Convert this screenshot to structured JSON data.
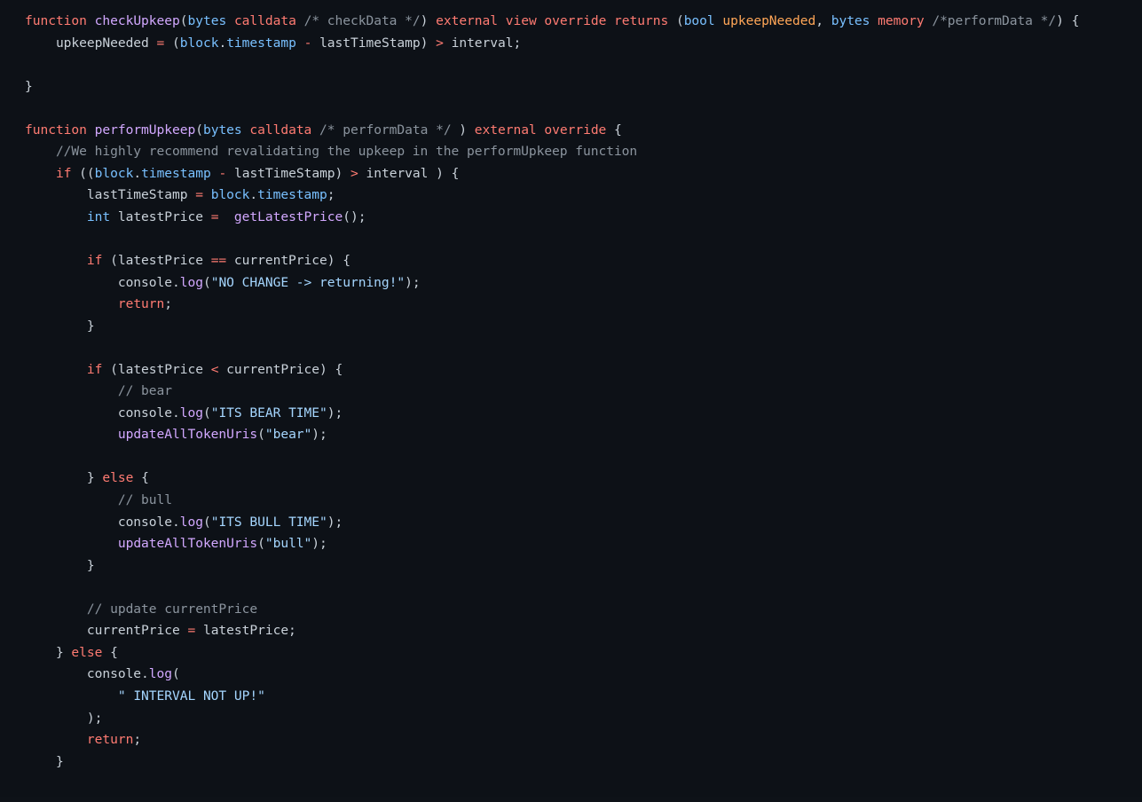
{
  "editor": {
    "language": "solidity",
    "background_color": "#0d1117",
    "default_text_color": "#c9d1d9",
    "theme_name": "github-dark"
  },
  "palette": {
    "keyword": "#ff7b72",
    "function": "#d2a8ff",
    "type": "#79c0ff",
    "string": "#a5d6ff",
    "comment": "#8b949e",
    "parameter": "#ffa657",
    "operator": "#ff7b72",
    "plain": "#c9d1d9"
  },
  "code": {
    "plain_text": "function checkUpkeep(bytes calldata /* checkData */) external view override returns (bool upkeepNeeded, bytes memory /*performData */) {\n    upkeepNeeded = (block.timestamp - lastTimeStamp) > interval;\n\n}\n\nfunction performUpkeep(bytes calldata /* performData */ ) external override {\n    //We highly recommend revalidating the upkeep in the performUpkeep function\n    if ((block.timestamp - lastTimeStamp) > interval ) {\n        lastTimeStamp = block.timestamp;\n        int latestPrice =  getLatestPrice();\n\n        if (latestPrice == currentPrice) {\n            console.log(\"NO CHANGE -> returning!\");\n            return;\n        }\n\n        if (latestPrice < currentPrice) {\n            // bear\n            console.log(\"ITS BEAR TIME\");\n            updateAllTokenUris(\"bear\");\n\n        } else {\n            // bull\n            console.log(\"ITS BULL TIME\");\n            updateAllTokenUris(\"bull\");\n        }\n\n        // update currentPrice\n        currentPrice = latestPrice;\n    } else {\n        console.log(\n            \" INTERVAL NOT UP!\"\n        );\n        return;\n    }",
    "lines": [
      {
        "n": 1,
        "tokens": [
          {
            "t": "function ",
            "c": "kw"
          },
          {
            "t": "checkUpkeep",
            "c": "fn"
          },
          {
            "t": "(",
            "c": "txt"
          },
          {
            "t": "bytes",
            "c": "type"
          },
          {
            "t": " ",
            "c": "txt"
          },
          {
            "t": "calldata",
            "c": "kw"
          },
          {
            "t": " ",
            "c": "txt"
          },
          {
            "t": "/* checkData */",
            "c": "cmt"
          },
          {
            "t": ") ",
            "c": "txt"
          },
          {
            "t": "external view override returns",
            "c": "kw"
          },
          {
            "t": " (",
            "c": "txt"
          },
          {
            "t": "bool",
            "c": "type"
          },
          {
            "t": " ",
            "c": "txt"
          },
          {
            "t": "upkeepNeeded",
            "c": "par"
          },
          {
            "t": ", ",
            "c": "txt"
          },
          {
            "t": "bytes",
            "c": "type"
          },
          {
            "t": " ",
            "c": "txt"
          },
          {
            "t": "memory",
            "c": "kw"
          },
          {
            "t": " ",
            "c": "txt"
          },
          {
            "t": "/*performData */",
            "c": "cmt"
          },
          {
            "t": ") {",
            "c": "txt"
          }
        ]
      },
      {
        "n": 2,
        "tokens": [
          {
            "t": "    upkeepNeeded ",
            "c": "txt"
          },
          {
            "t": "=",
            "c": "op"
          },
          {
            "t": " (",
            "c": "txt"
          },
          {
            "t": "block",
            "c": "type"
          },
          {
            "t": ".",
            "c": "txt"
          },
          {
            "t": "timestamp",
            "c": "prop"
          },
          {
            "t": " ",
            "c": "txt"
          },
          {
            "t": "-",
            "c": "op"
          },
          {
            "t": " lastTimeStamp) ",
            "c": "txt"
          },
          {
            "t": ">",
            "c": "op"
          },
          {
            "t": " interval;",
            "c": "txt"
          }
        ]
      },
      {
        "n": 3,
        "tokens": []
      },
      {
        "n": 4,
        "tokens": [
          {
            "t": "}",
            "c": "txt"
          }
        ]
      },
      {
        "n": 5,
        "tokens": []
      },
      {
        "n": 6,
        "tokens": [
          {
            "t": "function ",
            "c": "kw"
          },
          {
            "t": "performUpkeep",
            "c": "fn"
          },
          {
            "t": "(",
            "c": "txt"
          },
          {
            "t": "bytes",
            "c": "type"
          },
          {
            "t": " ",
            "c": "txt"
          },
          {
            "t": "calldata",
            "c": "kw"
          },
          {
            "t": " ",
            "c": "txt"
          },
          {
            "t": "/* performData */",
            "c": "cmt"
          },
          {
            "t": " ) ",
            "c": "txt"
          },
          {
            "t": "external override",
            "c": "kw"
          },
          {
            "t": " {",
            "c": "txt"
          }
        ]
      },
      {
        "n": 7,
        "tokens": [
          {
            "t": "    //We highly recommend revalidating the upkeep in the performUpkeep function",
            "c": "cmt"
          }
        ]
      },
      {
        "n": 8,
        "tokens": [
          {
            "t": "    ",
            "c": "txt"
          },
          {
            "t": "if",
            "c": "kw"
          },
          {
            "t": " ((",
            "c": "txt"
          },
          {
            "t": "block",
            "c": "type"
          },
          {
            "t": ".",
            "c": "txt"
          },
          {
            "t": "timestamp",
            "c": "prop"
          },
          {
            "t": " ",
            "c": "txt"
          },
          {
            "t": "-",
            "c": "op"
          },
          {
            "t": " lastTimeStamp) ",
            "c": "txt"
          },
          {
            "t": ">",
            "c": "op"
          },
          {
            "t": " interval ) {",
            "c": "txt"
          }
        ]
      },
      {
        "n": 9,
        "tokens": [
          {
            "t": "        lastTimeStamp ",
            "c": "txt"
          },
          {
            "t": "=",
            "c": "op"
          },
          {
            "t": " ",
            "c": "txt"
          },
          {
            "t": "block",
            "c": "type"
          },
          {
            "t": ".",
            "c": "txt"
          },
          {
            "t": "timestamp",
            "c": "prop"
          },
          {
            "t": ";",
            "c": "txt"
          }
        ]
      },
      {
        "n": 10,
        "tokens": [
          {
            "t": "        ",
            "c": "txt"
          },
          {
            "t": "int",
            "c": "type"
          },
          {
            "t": " latestPrice ",
            "c": "txt"
          },
          {
            "t": "=",
            "c": "op"
          },
          {
            "t": "  ",
            "c": "txt"
          },
          {
            "t": "getLatestPrice",
            "c": "fn"
          },
          {
            "t": "();",
            "c": "txt"
          }
        ]
      },
      {
        "n": 11,
        "tokens": []
      },
      {
        "n": 12,
        "tokens": [
          {
            "t": "        ",
            "c": "txt"
          },
          {
            "t": "if",
            "c": "kw"
          },
          {
            "t": " (latestPrice ",
            "c": "txt"
          },
          {
            "t": "==",
            "c": "op"
          },
          {
            "t": " currentPrice) {",
            "c": "txt"
          }
        ]
      },
      {
        "n": 13,
        "tokens": [
          {
            "t": "            console.",
            "c": "txt"
          },
          {
            "t": "log",
            "c": "fn"
          },
          {
            "t": "(",
            "c": "txt"
          },
          {
            "t": "\"NO CHANGE -> returning!\"",
            "c": "str"
          },
          {
            "t": ");",
            "c": "txt"
          }
        ]
      },
      {
        "n": 14,
        "tokens": [
          {
            "t": "            ",
            "c": "txt"
          },
          {
            "t": "return",
            "c": "kw"
          },
          {
            "t": ";",
            "c": "txt"
          }
        ]
      },
      {
        "n": 15,
        "tokens": [
          {
            "t": "        }",
            "c": "txt"
          }
        ]
      },
      {
        "n": 16,
        "tokens": []
      },
      {
        "n": 17,
        "tokens": [
          {
            "t": "        ",
            "c": "txt"
          },
          {
            "t": "if",
            "c": "kw"
          },
          {
            "t": " (latestPrice ",
            "c": "txt"
          },
          {
            "t": "<",
            "c": "op"
          },
          {
            "t": " currentPrice) {",
            "c": "txt"
          }
        ]
      },
      {
        "n": 18,
        "tokens": [
          {
            "t": "            // bear",
            "c": "cmt"
          }
        ]
      },
      {
        "n": 19,
        "tokens": [
          {
            "t": "            console.",
            "c": "txt"
          },
          {
            "t": "log",
            "c": "fn"
          },
          {
            "t": "(",
            "c": "txt"
          },
          {
            "t": "\"ITS BEAR TIME\"",
            "c": "str"
          },
          {
            "t": ");",
            "c": "txt"
          }
        ]
      },
      {
        "n": 20,
        "tokens": [
          {
            "t": "            ",
            "c": "txt"
          },
          {
            "t": "updateAllTokenUris",
            "c": "fn"
          },
          {
            "t": "(",
            "c": "txt"
          },
          {
            "t": "\"bear\"",
            "c": "str"
          },
          {
            "t": ");",
            "c": "txt"
          }
        ]
      },
      {
        "n": 21,
        "tokens": []
      },
      {
        "n": 22,
        "tokens": [
          {
            "t": "        } ",
            "c": "txt"
          },
          {
            "t": "else",
            "c": "kw"
          },
          {
            "t": " {",
            "c": "txt"
          }
        ]
      },
      {
        "n": 23,
        "tokens": [
          {
            "t": "            // bull",
            "c": "cmt"
          }
        ]
      },
      {
        "n": 24,
        "tokens": [
          {
            "t": "            console.",
            "c": "txt"
          },
          {
            "t": "log",
            "c": "fn"
          },
          {
            "t": "(",
            "c": "txt"
          },
          {
            "t": "\"ITS BULL TIME\"",
            "c": "str"
          },
          {
            "t": ");",
            "c": "txt"
          }
        ]
      },
      {
        "n": 25,
        "tokens": [
          {
            "t": "            ",
            "c": "txt"
          },
          {
            "t": "updateAllTokenUris",
            "c": "fn"
          },
          {
            "t": "(",
            "c": "txt"
          },
          {
            "t": "\"bull\"",
            "c": "str"
          },
          {
            "t": ");",
            "c": "txt"
          }
        ]
      },
      {
        "n": 26,
        "tokens": [
          {
            "t": "        }",
            "c": "txt"
          }
        ]
      },
      {
        "n": 27,
        "tokens": []
      },
      {
        "n": 28,
        "tokens": [
          {
            "t": "        // update currentPrice",
            "c": "cmt"
          }
        ]
      },
      {
        "n": 29,
        "tokens": [
          {
            "t": "        currentPrice ",
            "c": "txt"
          },
          {
            "t": "=",
            "c": "op"
          },
          {
            "t": " latestPrice;",
            "c": "txt"
          }
        ]
      },
      {
        "n": 30,
        "tokens": [
          {
            "t": "    } ",
            "c": "txt"
          },
          {
            "t": "else",
            "c": "kw"
          },
          {
            "t": " {",
            "c": "txt"
          }
        ]
      },
      {
        "n": 31,
        "tokens": [
          {
            "t": "        console.",
            "c": "txt"
          },
          {
            "t": "log",
            "c": "fn"
          },
          {
            "t": "(",
            "c": "txt"
          }
        ]
      },
      {
        "n": 32,
        "tokens": [
          {
            "t": "            ",
            "c": "txt"
          },
          {
            "t": "\" INTERVAL NOT UP!\"",
            "c": "str"
          }
        ]
      },
      {
        "n": 33,
        "tokens": [
          {
            "t": "        );",
            "c": "txt"
          }
        ]
      },
      {
        "n": 34,
        "tokens": [
          {
            "t": "        ",
            "c": "txt"
          },
          {
            "t": "return",
            "c": "kw"
          },
          {
            "t": ";",
            "c": "txt"
          }
        ]
      },
      {
        "n": 35,
        "tokens": [
          {
            "t": "    }",
            "c": "txt"
          }
        ]
      }
    ]
  }
}
